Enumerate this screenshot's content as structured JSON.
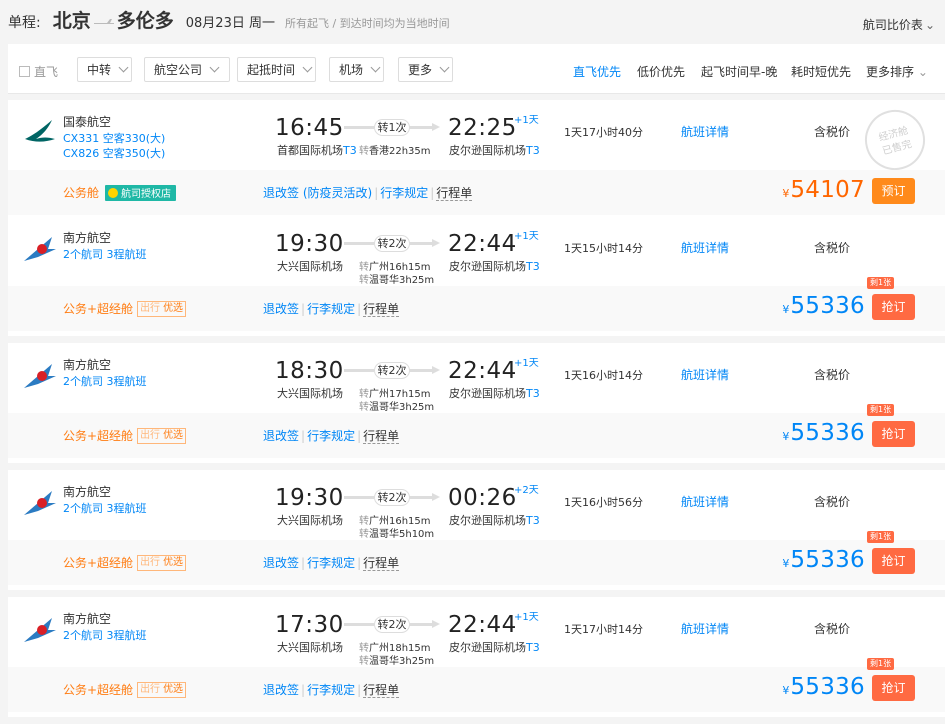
{
  "header": {
    "trip_type": "单程:",
    "from_city": "北京",
    "to_city": "多伦多",
    "date": "08月23日 周一",
    "note": "所有起飞 / 到达时间均为当地时间",
    "compare_label": "航司比价表"
  },
  "filters": {
    "direct_label": "直飞",
    "buttons": [
      "中转",
      "航空公司",
      "起抵时间",
      "机场",
      "更多"
    ],
    "sort_options": [
      "直飞优先",
      "低价优先",
      "起飞时间早-晚",
      "耗时短优先",
      "更多排序"
    ]
  },
  "flights": [
    {
      "airline": "国泰航空",
      "line1": "CX331 空客330(大)",
      "line2": "CX826 空客350(大)",
      "dep_time": "16:45",
      "dep_airport": "首都国际机场",
      "dep_terminal": "T3",
      "transfer": "转1次",
      "stop_tag1": "转",
      "stop1": "香港22h35m",
      "stop_tag2": "",
      "stop2": "",
      "arr_time": "22:25",
      "day_offset": "+1天",
      "arr_airport": "皮尔逊国际机场",
      "arr_terminal": "T3",
      "duration": "1天17小时40分",
      "detail_label": "航班详情",
      "tax_label": "含税价",
      "stamp": "经济舱 已售完",
      "cabin": "公务舱",
      "auth_badge": "航司授权店",
      "rules": [
        "退改签 (防疫灵活改)",
        "行李规定",
        "行程单"
      ],
      "currency": "¥",
      "price": "54107",
      "book_label": "预订",
      "left_tag": ""
    },
    {
      "airline": "南方航空",
      "line1": "2个航司  3程航班",
      "line2": "",
      "dep_time": "19:30",
      "dep_airport": "大兴国际机场",
      "dep_terminal": "",
      "transfer": "转2次",
      "stop_tag1": "转",
      "stop1": "广州16h15m",
      "stop_tag2": "转",
      "stop2": "温哥华3h25m",
      "arr_time": "22:44",
      "day_offset": "+1天",
      "arr_airport": "皮尔逊国际机场",
      "arr_terminal": "T3",
      "duration": "1天15小时14分",
      "detail_label": "航班详情",
      "tax_label": "含税价",
      "stamp": "",
      "cabin": "公务+超经舱",
      "badge_a": "出行",
      "badge_b": "优选",
      "rules": [
        "退改签",
        "行李规定",
        "行程单"
      ],
      "currency": "¥",
      "price": "55336",
      "book_label": "抢订",
      "left_tag": "剩1张"
    },
    {
      "airline": "南方航空",
      "line1": "2个航司  3程航班",
      "line2": "",
      "dep_time": "18:30",
      "dep_airport": "大兴国际机场",
      "dep_terminal": "",
      "transfer": "转2次",
      "stop_tag1": "转",
      "stop1": "广州17h15m",
      "stop_tag2": "转",
      "stop2": "温哥华3h25m",
      "arr_time": "22:44",
      "day_offset": "+1天",
      "arr_airport": "皮尔逊国际机场",
      "arr_terminal": "T3",
      "duration": "1天16小时14分",
      "detail_label": "航班详情",
      "tax_label": "含税价",
      "stamp": "",
      "cabin": "公务+超经舱",
      "badge_a": "出行",
      "badge_b": "优选",
      "rules": [
        "退改签",
        "行李规定",
        "行程单"
      ],
      "currency": "¥",
      "price": "55336",
      "book_label": "抢订",
      "left_tag": "剩1张"
    },
    {
      "airline": "南方航空",
      "line1": "2个航司  3程航班",
      "line2": "",
      "dep_time": "19:30",
      "dep_airport": "大兴国际机场",
      "dep_terminal": "",
      "transfer": "转2次",
      "stop_tag1": "转",
      "stop1": "广州16h15m",
      "stop_tag2": "转",
      "stop2": "温哥华5h10m",
      "arr_time": "00:26",
      "day_offset": "+2天",
      "arr_airport": "皮尔逊国际机场",
      "arr_terminal": "T3",
      "duration": "1天16小时56分",
      "detail_label": "航班详情",
      "tax_label": "含税价",
      "stamp": "",
      "cabin": "公务+超经舱",
      "badge_a": "出行",
      "badge_b": "优选",
      "rules": [
        "退改签",
        "行李规定",
        "行程单"
      ],
      "currency": "¥",
      "price": "55336",
      "book_label": "抢订",
      "left_tag": "剩1张"
    },
    {
      "airline": "南方航空",
      "line1": "2个航司  3程航班",
      "line2": "",
      "dep_time": "17:30",
      "dep_airport": "大兴国际机场",
      "dep_terminal": "",
      "transfer": "转2次",
      "stop_tag1": "转",
      "stop1": "广州18h15m",
      "stop_tag2": "转",
      "stop2": "温哥华3h25m",
      "arr_time": "22:44",
      "day_offset": "+1天",
      "arr_airport": "皮尔逊国际机场",
      "arr_terminal": "T3",
      "duration": "1天17小时14分",
      "detail_label": "航班详情",
      "tax_label": "含税价",
      "stamp": "",
      "cabin": "公务+超经舱",
      "badge_a": "出行",
      "badge_b": "优选",
      "rules": [
        "退改签",
        "行李规定",
        "行程单"
      ],
      "currency": "¥",
      "price": "55336",
      "book_label": "抢订",
      "left_tag": "剩1张"
    }
  ],
  "colors": {
    "accent_blue": "#0086f6",
    "price_orange": "#ff6600",
    "cabin_orange": "#ff7d13",
    "book_orange": "#ff8a1b",
    "book_red": "#ff6a42",
    "cathay_green": "#006564",
    "china_southern_blue": "#2b7bc2",
    "china_southern_red": "#d91f26"
  }
}
